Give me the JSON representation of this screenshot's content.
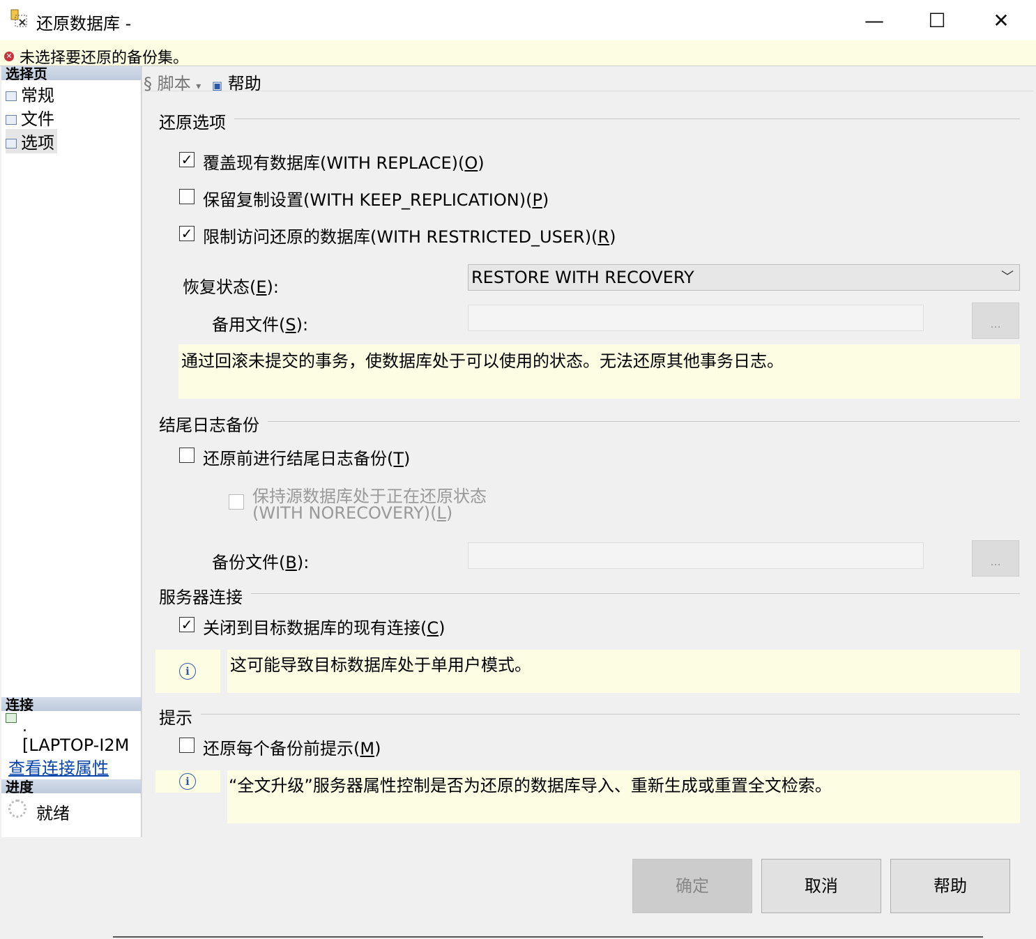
{
  "window": {
    "title": "还原数据库 -",
    "minimize_glyph": "—",
    "maximize_glyph": "☐",
    "close_glyph": "✕"
  },
  "error_bar": {
    "icon": "error-icon",
    "text": "未选择要还原的备份集。"
  },
  "left": {
    "select_page_header": "选择页",
    "pages": [
      "常规",
      "文件",
      "选项"
    ],
    "connection_header": "连接",
    "connection_dot": ".",
    "connection_server": "[LAPTOP-I2M",
    "view_connection_link": "查看连接属性",
    "progress_header": "进度",
    "progress_status": "就绪"
  },
  "toolbar": {
    "script_label": "脚本",
    "script_arrow": "▾",
    "help_label": "帮助"
  },
  "restore_options": {
    "header": "还原选项",
    "replace": {
      "label": "覆盖现有数据库(WITH REPLACE)(",
      "key": "O",
      "end": ")",
      "checked": true
    },
    "keep_replication": {
      "label": "保留复制设置(WITH KEEP_REPLICATION)(",
      "key": "P",
      "end": ")",
      "checked": false
    },
    "restricted_user": {
      "label": "限制访问还原的数据库(WITH RESTRICTED_USER)(",
      "key": "R",
      "end": ")",
      "checked": true
    },
    "recovery_state_label_pre": "恢复状态(",
    "recovery_state_key": "E",
    "recovery_state_label_post": "):",
    "recovery_state_value": "RESTORE WITH RECOVERY",
    "standby_file_label_pre": "备用文件(",
    "standby_file_key": "S",
    "standby_file_label_post": "):",
    "standby_file_value": "",
    "browse_label": "...",
    "description": "通过回滚未提交的事务，使数据库处于可以使用的状态。无法还原其他事务日志。"
  },
  "tail_log": {
    "header": "结尾日志备份",
    "take_tail_log": {
      "label": "还原前进行结尾日志备份(",
      "key": "T",
      "end": ")",
      "checked": false
    },
    "norecovery_line1": "保持源数据库处于正在还原状态",
    "norecovery_line2": "(WITH NORECOVERY)(",
    "norecovery_key": "L",
    "norecovery_end": ")",
    "norecovery_checked": false,
    "backup_file_label_pre": "备份文件(",
    "backup_file_key": "B",
    "backup_file_label_post": "):",
    "backup_file_value": "",
    "browse_label": "..."
  },
  "server_connection": {
    "header": "服务器连接",
    "close_connections": {
      "label": "关闭到目标数据库的现有连接(",
      "key": "C",
      "end": ")",
      "checked": true
    },
    "info_icon": "info-icon",
    "info_text": "这可能导致目标数据库处于单用户模式。"
  },
  "prompt": {
    "header": "提示",
    "prompt_before": {
      "label": "还原每个备份前提示(",
      "key": "M",
      "end": ")",
      "checked": false
    },
    "info_text": "“全文升级”服务器属性控制是否为还原的数据库导入、重新生成或重置全文检索。"
  },
  "buttons": {
    "ok": "确定",
    "cancel": "取消",
    "help": "帮助"
  }
}
